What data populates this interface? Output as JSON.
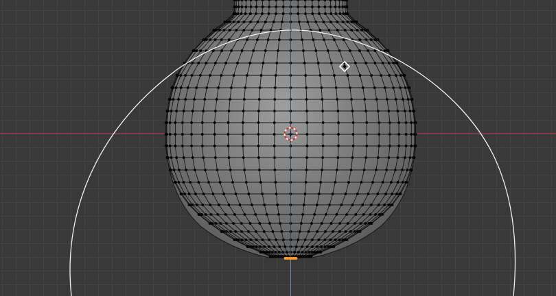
{
  "app": "3D viewport",
  "colors": {
    "background": "#393939",
    "grid_minor": "#434343",
    "grid_major": "#4c4c4c",
    "x_axis": "#b9404e",
    "z_axis": "#5d8ab0",
    "mesh_light": "#9e9e9e",
    "mesh_dark": "#5c5c5c",
    "wire": "#151515",
    "vertex": "#000000",
    "selected_vertex": "#ff9a1f",
    "brush_circle": "#f2f2f2",
    "cursor_red": "#e52b2b",
    "cursor_white": "#ffffff"
  },
  "icons": {
    "cursor": "3d-cursor-icon",
    "gizmo": "move-gizmo-icon"
  }
}
